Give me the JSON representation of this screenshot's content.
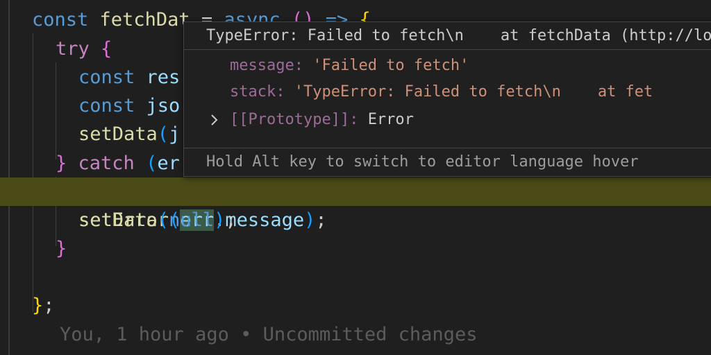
{
  "code": {
    "line1": {
      "kw": "const",
      "name": "fetchDat",
      "op": " = ",
      "async": "async",
      "parens": "()",
      "arrow": " => ",
      "brace": "{"
    },
    "line2": {
      "kw": "try",
      "brace": "{"
    },
    "line3": {
      "kw": "const",
      "name": "res"
    },
    "line4": {
      "kw": "const",
      "name": "jso"
    },
    "line5": {
      "fn": "setData",
      "paren": "(",
      "arg": "j"
    },
    "line6": {
      "brace": "}",
      "kw": "catch",
      "paren": "(",
      "arg": "er"
    },
    "line7": {
      "fn": "setError",
      "paren_open": "(",
      "obj": "err",
      "dot": ".",
      "prop": "message",
      "paren_close": ")",
      "semi": ";"
    },
    "line8": {
      "fn": "setData",
      "paren_open": "(",
      "arg": "null",
      "paren_close": ")",
      "semi": ";"
    },
    "line9": {
      "brace": "}"
    },
    "line11": {
      "brace": "}",
      "semi": ";"
    }
  },
  "blame": {
    "text": "You, 1 hour ago • Uncommitted changes"
  },
  "hover": {
    "header": "TypeError: Failed to fetch\\n    at fetchData (http://loc",
    "message_key": "message:",
    "message_value": "'Failed to fetch'",
    "stack_key": "stack:",
    "stack_value": "'TypeError: Failed to fetch\\n    at fet",
    "prototype_key": "[[Prototype]]:",
    "prototype_value": "Error",
    "footer": "Hold Alt key to switch to editor language hover"
  },
  "icons": {
    "expand": "chevron-right-icon"
  },
  "colors": {
    "background": "#1f1f1f",
    "highlight_line": "#4b4b18",
    "keyword": "#569cd6",
    "control": "#c586c0",
    "function": "#dcdcaa",
    "variable": "#9cdcfe",
    "string": "#ce9178"
  }
}
